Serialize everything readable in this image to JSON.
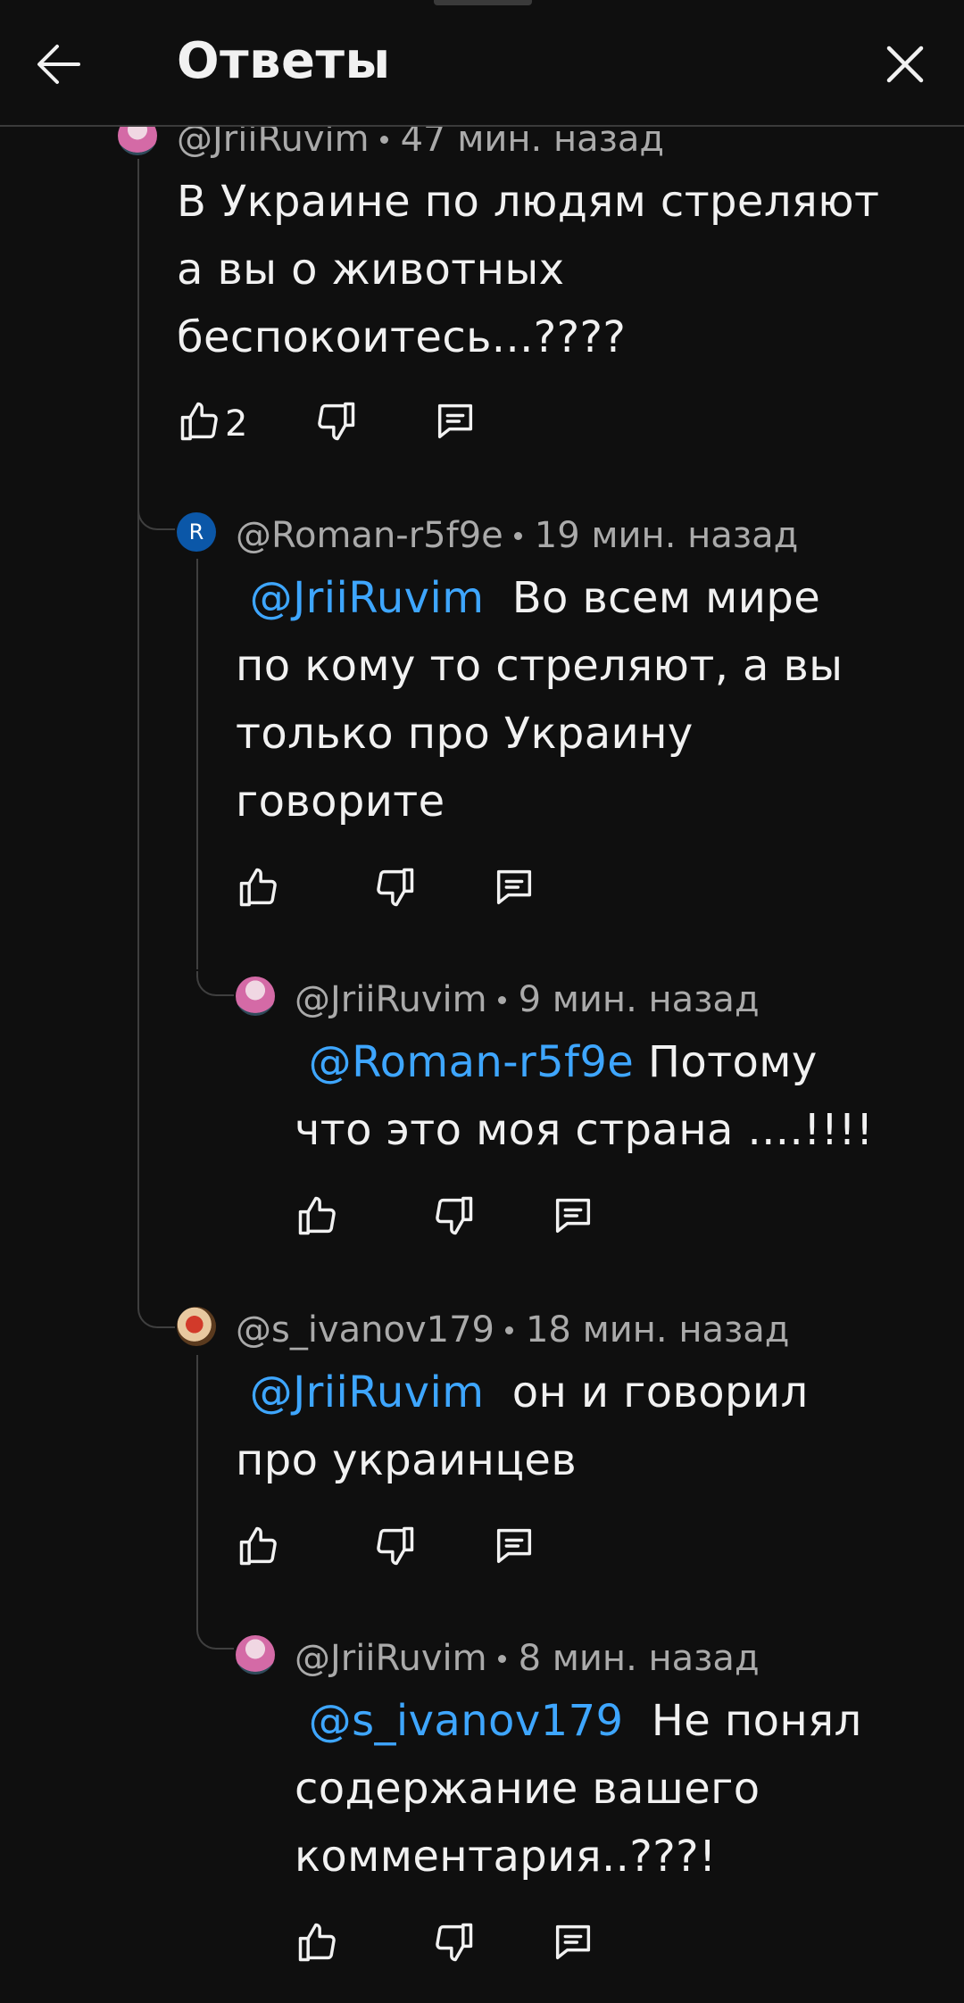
{
  "header": {
    "title": "Ответы"
  },
  "comments": [
    {
      "author": "@JriiRuvim",
      "time": "47 мин. назад",
      "line1": "В Украине по людям стреляют",
      "line2": "а вы о животных",
      "line3": "беспокоитесь...????",
      "likes": "2"
    },
    {
      "author": "@Roman-r5f9e",
      "time": "19 мин. назад",
      "avatar_letter": "R",
      "mention": "@JriiRuvim",
      "line1": "Во всем мире",
      "line2": "по кому то стреляют, а вы",
      "line3": "только про Украину",
      "line4": "говорите"
    },
    {
      "author": "@JriiRuvim",
      "time": "9 мин. назад",
      "mention": "@Roman-r5f9e",
      "line1": "Потому",
      "line2": "что это моя страна ....!!!!"
    },
    {
      "author": "@s_ivanov179",
      "time": "18 мин. назад",
      "mention": "@JriiRuvim",
      "line1": "он и говорил",
      "line2": "про украинцев"
    },
    {
      "author": "@JriiRuvim",
      "time": "8 мин. назад",
      "mention": "@s_ivanov179",
      "line1": "Не понял",
      "line2": "содержание вашего",
      "line3": "комментария..???!"
    }
  ],
  "colors": {
    "background": "#0f0f0f",
    "text": "#f1f1f1",
    "meta": "#aaaaaa",
    "mention": "#3ea6ff",
    "thread_line": "#3f3f3f"
  },
  "icons": [
    "back-arrow-icon",
    "close-icon",
    "thumb-up-icon",
    "thumb-down-icon",
    "reply-icon"
  ]
}
